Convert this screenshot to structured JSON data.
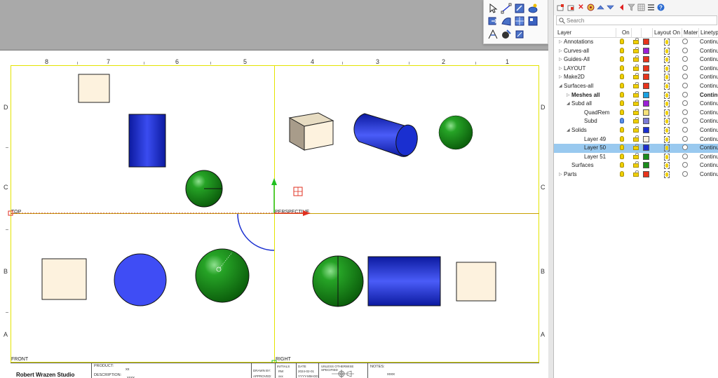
{
  "viewport": {
    "ruler_numbers": [
      "8",
      "7",
      "6",
      "5",
      "4",
      "3",
      "2",
      "1"
    ],
    "ruler_letters": [
      "D",
      "C",
      "B",
      "A"
    ],
    "labels": {
      "top": "TOP",
      "perspective": "PERSPECTIVE",
      "front": "FRONT",
      "right": "RIGHT"
    },
    "colors": {
      "frame": "#e4e400",
      "x_axis": "#e03020",
      "y_axis": "#20c020",
      "blue_solid": "#1a2fd0",
      "green_solid": "#1a8c1a",
      "cream_box": "#fdf2de"
    }
  },
  "title_block": {
    "studio_name": "Robert Wrazen Studio",
    "product_label": "PRODUCT:",
    "product_value": "xx",
    "description_label": "DESCRIPTION:",
    "description_value": "xxxx",
    "initials_label": "INITIALS",
    "date_label": "DATE",
    "drawn_by_label": "DRAWN BY:",
    "drawn_by_value": "RW",
    "drawn_date": "2024-02-01",
    "approved_label": "APPROVED:",
    "approved_value": "xxx",
    "approved_date": "YYYY-MM-DD",
    "unless_text": "UNLESS OTHERWISE SPECIFIED",
    "notes_label": "NOTES:",
    "notes_value": "xxxx"
  },
  "toolbox": {
    "icons": [
      "select-icon",
      "points-icon",
      "transform-icon",
      "render-icon",
      "pan-icon",
      "surface-icon",
      "mesh-icon",
      "layout-icon",
      "wire-icon",
      "material-icon",
      "dimension-icon"
    ]
  },
  "layers_panel": {
    "toolbar_icons": [
      "new-layer-icon",
      "new-sublayer-icon",
      "delete-icon",
      "filter-materials-icon",
      "move-up-icon",
      "move-down-icon",
      "collapse-icon",
      "funnel-icon",
      "columns-icon",
      "list-icon",
      "help-icon"
    ],
    "search_placeholder": "Search",
    "columns": {
      "layer": "Layer",
      "on": "On",
      "layout_on": "Layout On",
      "material": "Mater",
      "linetype": "Linetyp"
    },
    "rows": [
      {
        "name": "Annotations",
        "indent": 0,
        "tri": "▷",
        "color": "#e8341c",
        "bulb": "yellow",
        "linetype": "Continu",
        "bold": false,
        "selected": false
      },
      {
        "name": "Curves-all",
        "indent": 0,
        "tri": "▷",
        "color": "#9b1fd6",
        "bulb": "yellow",
        "linetype": "Continu",
        "bold": false,
        "selected": false
      },
      {
        "name": "Guides-All",
        "indent": 0,
        "tri": "▷",
        "color": "#e8341c",
        "bulb": "yellow",
        "linetype": "Continu",
        "bold": false,
        "selected": false
      },
      {
        "name": "LAYOUT",
        "indent": 0,
        "tri": "▷",
        "color": "#e8341c",
        "bulb": "yellow",
        "linetype": "Continu",
        "bold": false,
        "selected": false
      },
      {
        "name": "Make2D",
        "indent": 0,
        "tri": "▷",
        "color": "#e8341c",
        "bulb": "yellow",
        "linetype": "Continu",
        "bold": false,
        "selected": false
      },
      {
        "name": "Surfaces-all",
        "indent": 0,
        "tri": "◢",
        "color": "#e8341c",
        "bulb": "yellow",
        "linetype": "Continu",
        "bold": false,
        "selected": false
      },
      {
        "name": "Meshes all",
        "indent": 1,
        "tri": "▷",
        "color": "#1aa0e0",
        "bulb": "yellow",
        "linetype": "Continu",
        "bold": true,
        "selected": false
      },
      {
        "name": "Subd all",
        "indent": 1,
        "tri": "◢",
        "color": "#9b1fd6",
        "bulb": "yellow",
        "linetype": "Continu",
        "bold": false,
        "selected": false
      },
      {
        "name": "QuadRem",
        "indent": 2,
        "tri": "",
        "color": "#f6e27a",
        "bulb": "yellow",
        "linetype": "Continu",
        "bold": false,
        "selected": false
      },
      {
        "name": "Subd",
        "indent": 2,
        "tri": "",
        "color": "#7a7ad6",
        "bulb": "blue",
        "linetype": "Continu",
        "bold": false,
        "selected": false
      },
      {
        "name": "Solids",
        "indent": 1,
        "tri": "◢",
        "color": "#1a2fd0",
        "bulb": "yellow",
        "linetype": "Continu",
        "bold": false,
        "selected": false
      },
      {
        "name": "Layer 49",
        "indent": 2,
        "tri": "",
        "color": "#fdf2de",
        "bulb": "yellow",
        "linetype": "Continu",
        "bold": false,
        "selected": false
      },
      {
        "name": "Layer 50",
        "indent": 2,
        "tri": "",
        "color": "#1a2fd0",
        "bulb": "yellow",
        "linetype": "Continu",
        "bold": false,
        "selected": true
      },
      {
        "name": "Layer 51",
        "indent": 2,
        "tri": "",
        "color": "#1a8c1a",
        "bulb": "yellow",
        "linetype": "Continu",
        "bold": false,
        "selected": false
      },
      {
        "name": "Surfaces",
        "indent": 1,
        "tri": "",
        "color": "#1a8c1a",
        "bulb": "yellow",
        "linetype": "Continu",
        "bold": false,
        "selected": false
      },
      {
        "name": "Parts",
        "indent": 0,
        "tri": "▷",
        "color": "#e8341c",
        "bulb": "yellow",
        "linetype": "Continu",
        "bold": false,
        "selected": false
      }
    ]
  }
}
